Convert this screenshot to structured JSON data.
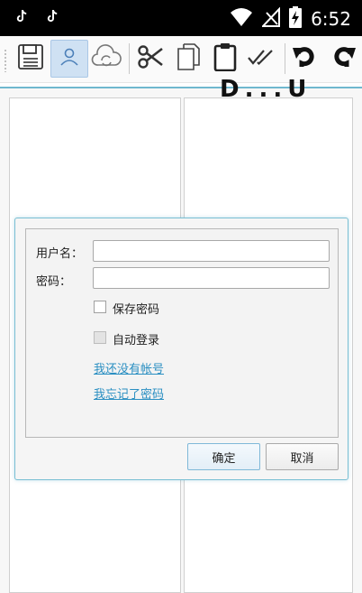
{
  "status_bar": {
    "time": "6:52",
    "left_icons": [
      "tiktok-icon",
      "tiktok-icon"
    ],
    "right_icons": [
      "wifi-icon",
      "no-signal-icon",
      "battery-charging-icon"
    ]
  },
  "toolbar": {
    "buttons": [
      "save-icon",
      "user-icon",
      "cloud-sync-icon",
      "scissors-icon",
      "copy-icon",
      "clipboard-icon",
      "double-check-icon",
      "undo-icon",
      "redo-icon"
    ],
    "active": "user-icon"
  },
  "background": {
    "big_text": "D...U"
  },
  "login_dialog": {
    "username_label": "用户名：",
    "username_value": "",
    "password_label": "密码：",
    "password_value": "",
    "save_password_label": "保存密码",
    "save_password_checked": false,
    "auto_login_label": "自动登录",
    "auto_login_checked": false,
    "register_link": "我还没有帐号",
    "forgot_link": "我忘记了密码",
    "ok_label": "确定",
    "cancel_label": "取消"
  },
  "colors": {
    "accent": "#79bfd3",
    "link": "#2a8fc2"
  }
}
